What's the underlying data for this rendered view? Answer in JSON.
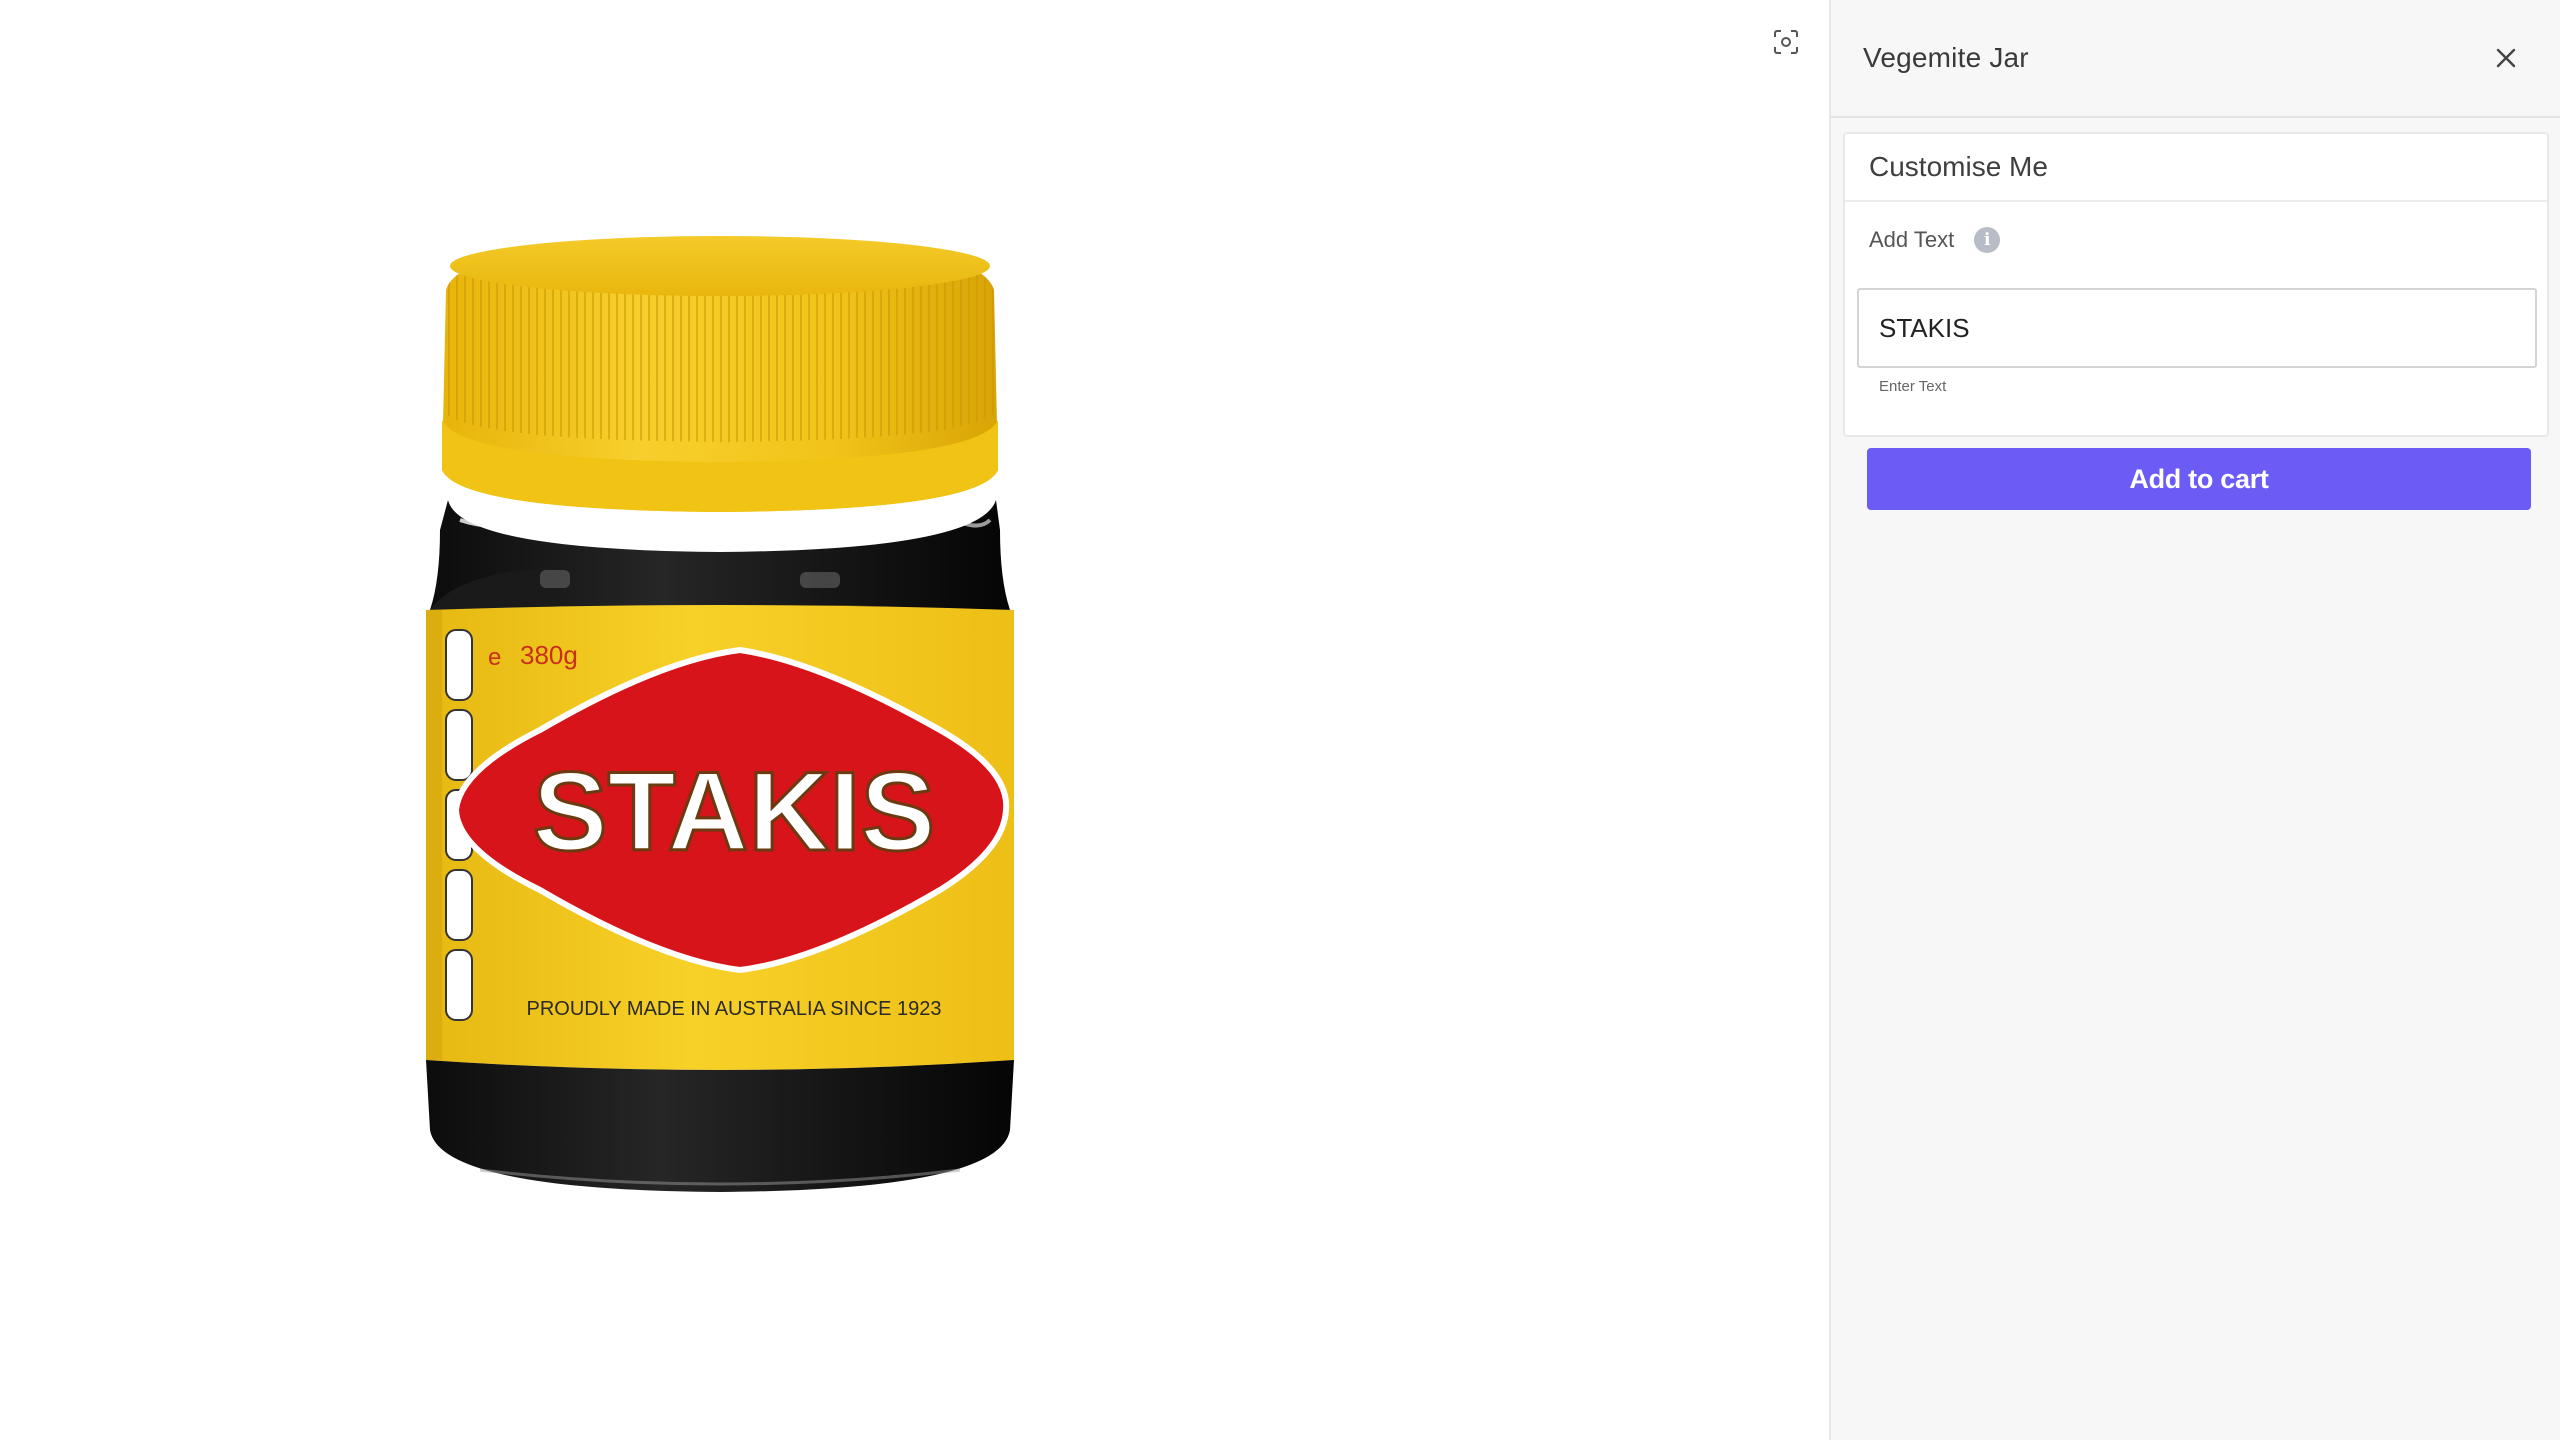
{
  "viewer": {
    "screenshot_icon": "screenshot-icon",
    "product": {
      "label_text": "STAKIS",
      "weight": "380g",
      "weight_symbol": "e",
      "tagline": "PROUDLY MADE IN AUSTRALIA SINCE 1923"
    }
  },
  "panel": {
    "title": "Vegemite Jar",
    "close_icon": "close-icon",
    "section_title": "Customise Me",
    "field_label": "Add Text",
    "info_icon": "info-icon",
    "input_value": "STAKIS",
    "helper_text": "Enter Text",
    "add_to_cart_label": "Add to cart"
  },
  "colors": {
    "accent": "#6b5cf6",
    "lid_yellow": "#f2c40f",
    "label_yellow": "#f5cb1e",
    "label_red": "#d7141a"
  }
}
